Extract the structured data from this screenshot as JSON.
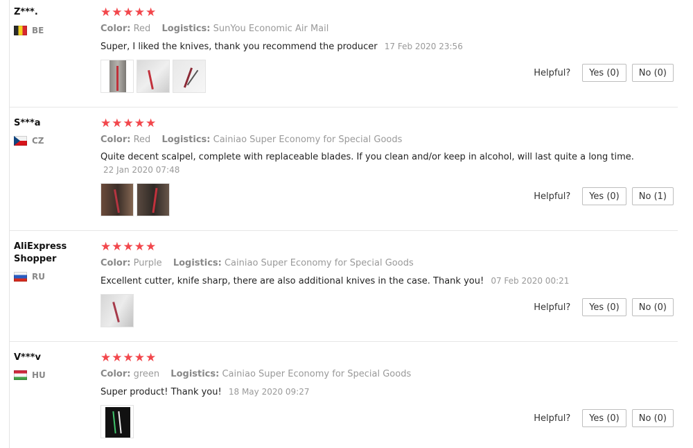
{
  "helpful_label": "Helpful?",
  "stars": [
    "★",
    "★",
    "★",
    "★",
    "★"
  ],
  "color_label": "Color:",
  "logistics_label": "Logistics:",
  "reviews": [
    {
      "user": "Z***.",
      "country": "BE",
      "color": "Red",
      "logistics": "SunYou Economic Air Mail",
      "text": "Super, I liked the knives, thank you recommend the producer",
      "date": "17 Feb 2020 23:56",
      "yes": "Yes (0)",
      "no": "No (0)"
    },
    {
      "user": "S***a",
      "country": "CZ",
      "color": "Red",
      "logistics": "Cainiao Super Economy for Special Goods",
      "text": "Quite decent scalpel, complete with replaceable blades. If you clean and/or keep in alcohol, will last quite a long time.",
      "date": "22 Jan 2020 07:48",
      "yes": "Yes (0)",
      "no": "No (1)"
    },
    {
      "user": "AliExpress Shopper",
      "country": "RU",
      "color": "Purple",
      "logistics": "Cainiao Super Economy for Special Goods",
      "text": "Excellent cutter, knife sharp, there are also additional knives in the case. Thank you!",
      "date": "07 Feb 2020 00:21",
      "yes": "Yes (0)",
      "no": "No (0)"
    },
    {
      "user": "V***v",
      "country": "HU",
      "color": "green",
      "logistics": "Cainiao Super Economy for Special Goods",
      "text": "Super product! Thank you!",
      "date": "18 May 2020 09:27",
      "yes": "Yes (0)",
      "no": "No (0)"
    }
  ],
  "colors": {
    "star": "#f2474c",
    "divider": "#e6e6e6"
  }
}
